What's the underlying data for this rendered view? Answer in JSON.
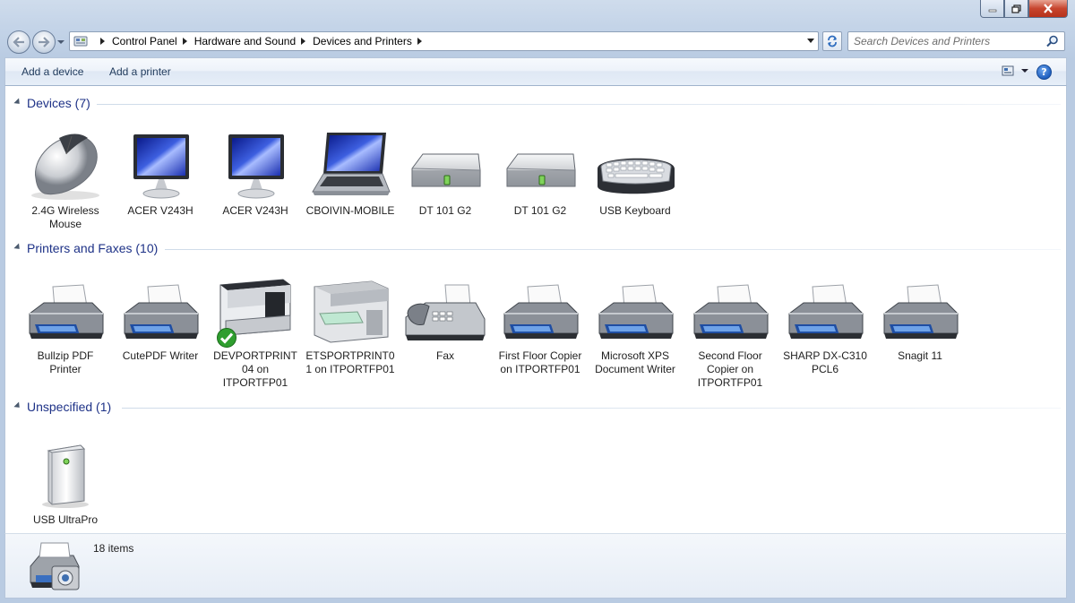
{
  "window": {
    "controls": {
      "minimize": "minimize",
      "maximize": "maximize",
      "close": "close"
    }
  },
  "address": {
    "breadcrumbs": [
      "Control Panel",
      "Hardware and Sound",
      "Devices and Printers"
    ],
    "search_placeholder": "Search Devices and Printers"
  },
  "toolbar": {
    "add_device": "Add a device",
    "add_printer": "Add a printer"
  },
  "groups": [
    {
      "title": "Devices (7)",
      "items": [
        {
          "label": "2.4G Wireless Mouse",
          "icon": "mouse"
        },
        {
          "label": "ACER V243H",
          "icon": "monitor"
        },
        {
          "label": "ACER V243H",
          "icon": "monitor"
        },
        {
          "label": "CBOIVIN-MOBILE",
          "icon": "laptop"
        },
        {
          "label": "DT 101 G2",
          "icon": "drive"
        },
        {
          "label": "DT 101 G2",
          "icon": "drive"
        },
        {
          "label": "USB Keyboard",
          "icon": "keyboard"
        }
      ]
    },
    {
      "title": "Printers and Faxes (10)",
      "items": [
        {
          "label": "Bullzip PDF Printer",
          "icon": "printer"
        },
        {
          "label": "CutePDF Writer",
          "icon": "printer"
        },
        {
          "label": "DEVPORTPRINT04 on ITPORTFP01",
          "icon": "laser-printer",
          "default": true
        },
        {
          "label": "ETSPORTPRINT01 on ITPORTFP01",
          "icon": "copier"
        },
        {
          "label": "Fax",
          "icon": "fax"
        },
        {
          "label": "First Floor Copier on ITPORTFP01",
          "icon": "printer"
        },
        {
          "label": "Microsoft XPS Document Writer",
          "icon": "printer"
        },
        {
          "label": "Second Floor Copier on ITPORTFP01",
          "icon": "printer"
        },
        {
          "label": "SHARP DX-C310 PCL6",
          "icon": "printer"
        },
        {
          "label": "Snagit 11",
          "icon": "printer"
        }
      ]
    },
    {
      "title": "Unspecified (1)",
      "items": [
        {
          "label": "USB UltraPro",
          "icon": "tower"
        }
      ]
    }
  ],
  "status": {
    "count": "18 items"
  }
}
